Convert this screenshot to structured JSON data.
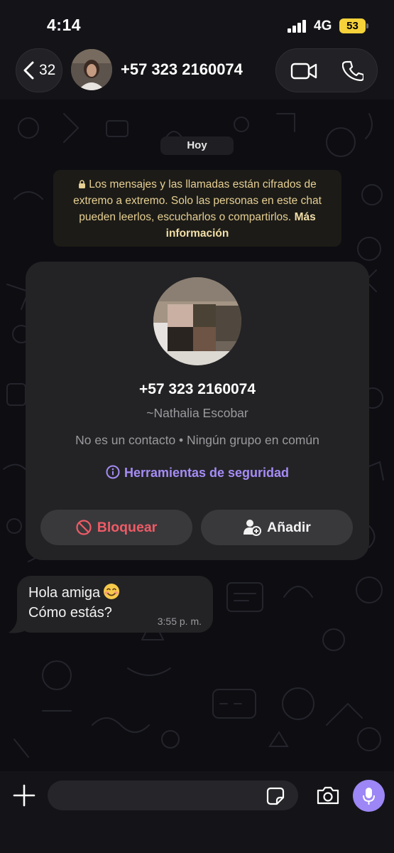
{
  "status_bar": {
    "time": "4:14",
    "network": "4G",
    "battery": "53"
  },
  "header": {
    "back_count": "32",
    "contact_title": "+57 323 2160074",
    "icons": [
      "chevron-left-icon",
      "video-call-icon",
      "phone-call-icon"
    ]
  },
  "chat": {
    "date_chip": "Hoy",
    "encryption_notice": {
      "text": "Los mensajes y las llamadas están cifrados de extremo a extremo. Solo las personas en este chat pueden leerlos, escucharlos o compartirlos.",
      "link": "Más información"
    },
    "contact_card": {
      "phone": "+57 323 2160074",
      "name": "~Nathalia Escobar",
      "status": "No es un contacto • Ningún grupo en común",
      "security_tools": "Herramientas de seguridad",
      "block_label": "Bloquear",
      "add_label": "Añadir"
    },
    "messages": [
      {
        "line1": "Hola amiga",
        "line2": "Cómo estás?",
        "time": "3:55 p. m.",
        "emoji": "smiling-face"
      }
    ]
  },
  "composer": {
    "placeholder": ""
  },
  "colors": {
    "accent": "#9d86f5",
    "link": "#a58cf6",
    "danger": "#ef5b66",
    "notice_text": "#e6cf93",
    "battery": "#f5d23a"
  }
}
